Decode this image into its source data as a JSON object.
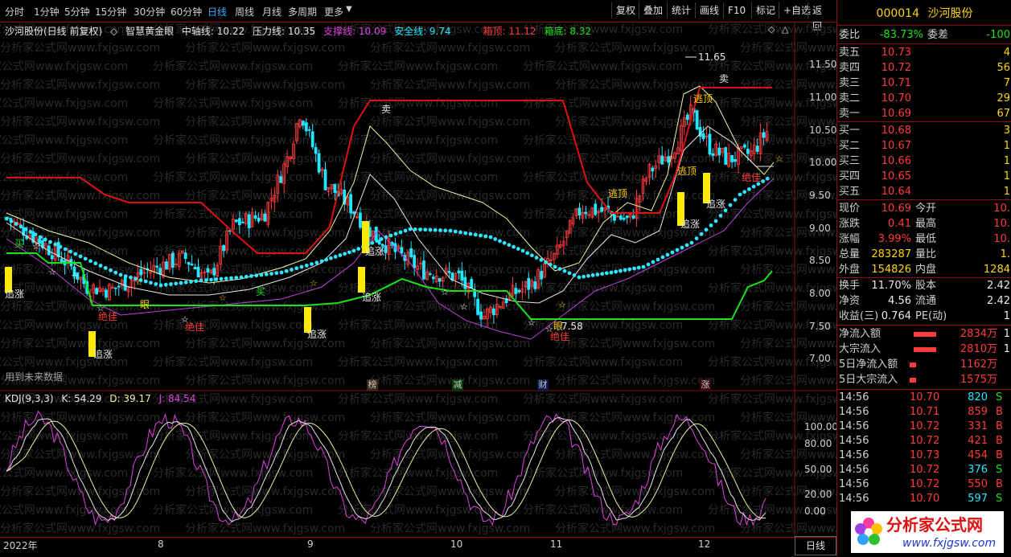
{
  "toolbar": {
    "periods": [
      "分时",
      "1分钟",
      "5分钟",
      "15分钟",
      "30分钟",
      "60分钟",
      "日线",
      "周线",
      "月线",
      "多周期",
      "更多"
    ],
    "active_period": "日线",
    "buttons": [
      "复权",
      "叠加",
      "统计",
      "画线",
      "F10",
      "标记",
      "+自选",
      "返回"
    ]
  },
  "main": {
    "stock_label": "沙河股份(日线 前复权)",
    "indicator_name": "智慧黄金眼",
    "mid_label": "中轴线: 10.22",
    "pressure_label": "压力线: 10.35",
    "support_label": "支撑线: 10.09",
    "safety_label": "安全线: 9.74",
    "box_top_label": "箱顶: 11.12",
    "box_bottom_label": "箱底: 8.32",
    "future_note": "用到未来数据",
    "high_mark": "11.65",
    "low_mark": "7.58",
    "y_ticks": [
      "11.50",
      "11.00",
      "10.50",
      "10.00",
      "9.50",
      "9.00",
      "8.50",
      "8.00",
      "7.50",
      "7.00"
    ],
    "event_tags": [
      {
        "text": "榜",
        "color": "#c9a070"
      },
      {
        "text": "减",
        "color": "#19c219"
      },
      {
        "text": "财",
        "color": "#3a7bff"
      },
      {
        "text": "涨",
        "color": "#ff5050"
      }
    ],
    "signals": {
      "buy": "买",
      "sell": "卖",
      "chase": "追涨",
      "watch": "眼",
      "best": "绝佳",
      "escape": "逃顶"
    }
  },
  "kdj": {
    "title": "KDJ(9,3,3)",
    "k_label": "K: 54.29",
    "d_label": "D: 39.17",
    "j_label": "J: 84.54",
    "y_ticks": [
      "100.00",
      "80.00",
      "50.00",
      "20.00",
      "0.00"
    ]
  },
  "x_axis": {
    "labels": [
      "2022年",
      "8",
      "9",
      "10",
      "11",
      "12"
    ],
    "period_button": "日线"
  },
  "colors": {
    "up": "#ff3b3b",
    "down": "#22e6ff",
    "box_line": "#e01010",
    "safety_line": "#19e219",
    "mid_dots": "#2ee6ff",
    "band": "#f2f0a0",
    "lower_band": "#c040e0",
    "chase_bar": "#ffea00",
    "j_line": "#e040e0"
  },
  "panel": {
    "code": "000014",
    "name": "沙河股份",
    "weibi_label": "委比",
    "weibi_value": "-83.73%",
    "weicha_label": "委差",
    "weicha_value": "-100",
    "asks": [
      {
        "label": "卖五",
        "price": "10.73",
        "vol": "4"
      },
      {
        "label": "卖四",
        "price": "10.72",
        "vol": "56"
      },
      {
        "label": "卖三",
        "price": "10.71",
        "vol": "7"
      },
      {
        "label": "卖二",
        "price": "10.70",
        "vol": "29"
      },
      {
        "label": "卖一",
        "price": "10.69",
        "vol": "67"
      }
    ],
    "bids": [
      {
        "label": "买一",
        "price": "10.68",
        "vol": "3"
      },
      {
        "label": "买二",
        "price": "10.67",
        "vol": "1"
      },
      {
        "label": "买三",
        "price": "10.66",
        "vol": "1"
      },
      {
        "label": "买四",
        "price": "10.65",
        "vol": "1"
      },
      {
        "label": "买五",
        "price": "10.64",
        "vol": "1"
      }
    ],
    "quote": [
      {
        "l1": "现价",
        "v1": "10.69",
        "l2": "今开",
        "v2": "10."
      },
      {
        "l1": "涨跌",
        "v1": "0.41",
        "l2": "最高",
        "v2": "10."
      },
      {
        "l1": "涨幅",
        "v1": "3.99%",
        "l2": "最低",
        "v2": "10."
      },
      {
        "l1": "总量",
        "v1": "283287",
        "l2": "量比",
        "v2": "1."
      },
      {
        "l1": "外盘",
        "v1": "154826",
        "l2": "内盘",
        "v2": "1284"
      }
    ],
    "stats": [
      {
        "l1": "换手",
        "v1": "11.70%",
        "l2": "股本",
        "v2": "2.42"
      },
      {
        "l1": "净资",
        "v1": "4.56",
        "l2": "流通",
        "v2": "2.42"
      },
      {
        "l1": "收益(三)",
        "v1": "0.764",
        "l2": "PE(动)",
        "v2": "1"
      }
    ],
    "flows": [
      {
        "label": "净流入额",
        "value": "2834万",
        "extra": "1"
      },
      {
        "label": "大宗流入",
        "value": "2810万",
        "extra": "1"
      },
      {
        "label": "5日净流入额",
        "value": "1162万",
        "extra": ""
      },
      {
        "label": "5日大宗流入",
        "value": "1575万",
        "extra": ""
      }
    ],
    "ticks": [
      {
        "time": "14:56",
        "price": "10.70",
        "vol": "820",
        "bs": "S"
      },
      {
        "time": "14:56",
        "price": "10.71",
        "vol": "859",
        "bs": "B"
      },
      {
        "time": "14:56",
        "price": "10.72",
        "vol": "331",
        "bs": "B"
      },
      {
        "time": "14:56",
        "price": "10.72",
        "vol": "421",
        "bs": "B"
      },
      {
        "time": "14:56",
        "price": "10.73",
        "vol": "454",
        "bs": "B"
      },
      {
        "time": "14:56",
        "price": "10.72",
        "vol": "376",
        "bs": "S"
      },
      {
        "time": "14:56",
        "price": "10.72",
        "vol": "550",
        "bs": "B"
      },
      {
        "time": "14:56",
        "price": "10.70",
        "vol": "597",
        "bs": "S"
      }
    ],
    "logo_text": "分析家公式网",
    "logo_url": "www.fxjgsw.com"
  },
  "watermark": "分析家公式网www.fxjgsw.com"
}
